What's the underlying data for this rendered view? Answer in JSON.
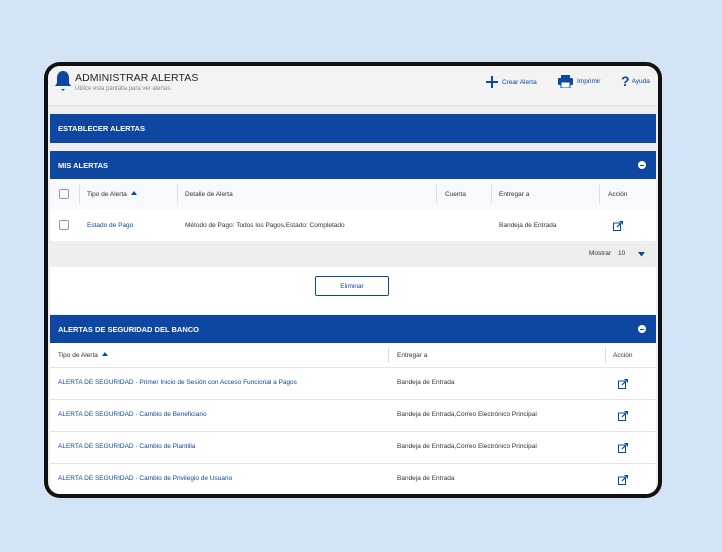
{
  "header": {
    "title": "ADMINISTRAR ALERTAS",
    "subtitle": "Utilice esta pantalla para ver alertas.",
    "actions": {
      "create": "Crear Alerta",
      "print": "Imprimir",
      "help": "Ayuda"
    }
  },
  "sections": {
    "establecer": "ESTABLECER ALERTAS",
    "mis_alertas": "MIS ALERTAS",
    "seguridad": "ALERTAS DE SEGURIDAD DEL BANCO"
  },
  "mis_alertas": {
    "columns": {
      "tipo": "Tipo de Alerta",
      "detalle": "Detalle de Alerta",
      "cuenta": "Cuenta",
      "entregar": "Entregar a",
      "accion": "Acción"
    },
    "rows": [
      {
        "tipo": "Estado de Pago",
        "detalle": "Método de Pago: Todos los Pagos,Estado: Completado",
        "cuenta": "",
        "entregar": "Bandeja de Entrada"
      }
    ],
    "pagination": {
      "label": "Mostrar",
      "value": "10"
    },
    "delete_button": "Eliminar"
  },
  "seguridad": {
    "columns": {
      "tipo": "Tipo de Alerta",
      "entregar": "Entregar a",
      "accion": "Acción"
    },
    "rows": [
      {
        "tipo": "ALERTA DE SEGURIDAD - Primer Inicio de Sesión con Acceso Funcional a Pagos",
        "entregar": "Bandeja de Entrada"
      },
      {
        "tipo": "ALERTA DE SEGURIDAD - Cambio de Beneficiario",
        "entregar": "Bandeja de Entrada,Correo Electrónico Principal"
      },
      {
        "tipo": "ALERTA DE SEGURIDAD - Cambio de Plantilla",
        "entregar": "Bandeja de Entrada,Correo Electrónico Principal"
      },
      {
        "tipo": "ALERTA DE SEGURIDAD - Cambio de Privilegio de Usuario",
        "entregar": "Bandeja de Entrada"
      }
    ]
  },
  "colors": {
    "primary": "#0d47a1",
    "background": "#d3e4f7"
  }
}
